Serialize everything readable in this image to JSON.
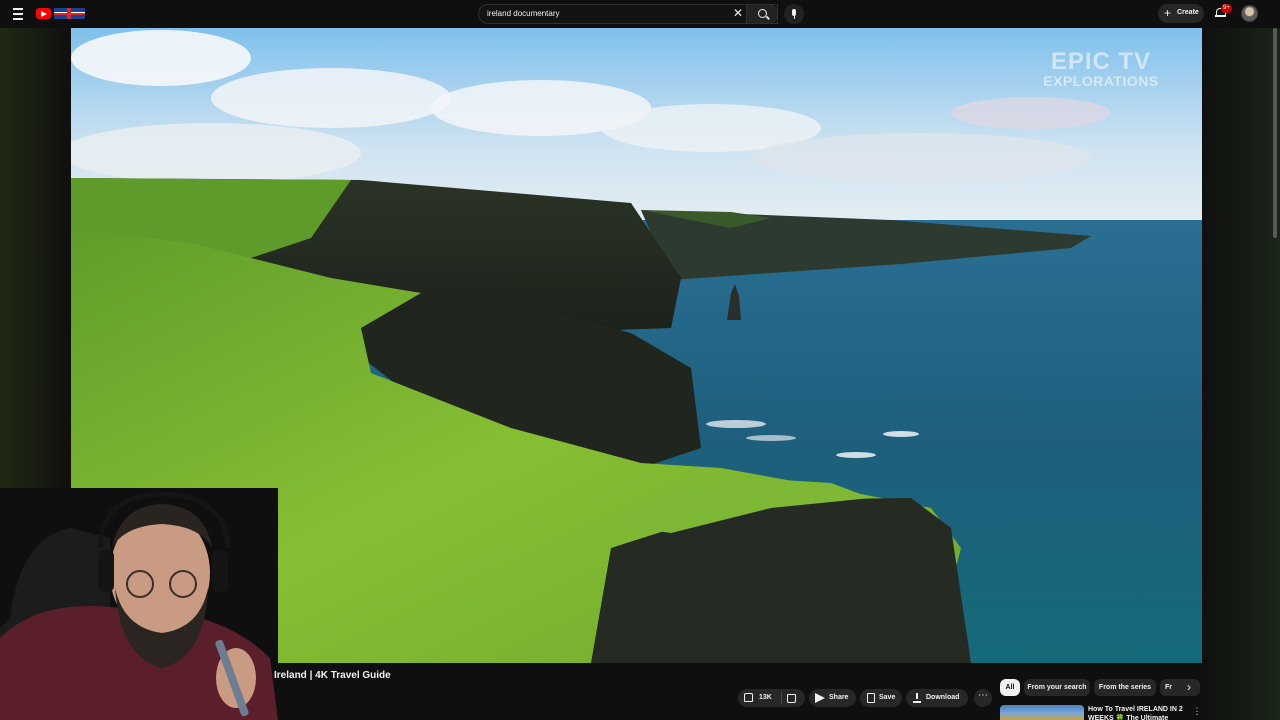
{
  "header": {
    "search_query": "ireland documentary",
    "create_label": "Create",
    "notification_count": "9+"
  },
  "video": {
    "watermark_line1": "EPIC TV",
    "watermark_line2": "EXPLORATIONS",
    "title": "Ireland | 4K Travel Guide"
  },
  "actions": {
    "like_count": "13K",
    "share_label": "Share",
    "save_label": "Save",
    "download_label": "Download"
  },
  "chips": [
    "All",
    "From your search",
    "From the series",
    "Fr"
  ],
  "recommendation": {
    "title": "How To Travel IRELAND IN 2 WEEKS 🍀 The Ultimate"
  },
  "colors": {
    "background": "#0f0f0f",
    "surface": "#272727",
    "accent": "#ff0000",
    "text": "#f1f1f1"
  },
  "icons": [
    "menu-icon",
    "youtube-logo-icon",
    "uk-flag-icon",
    "clear-icon",
    "search-icon",
    "microphone-icon",
    "plus-icon",
    "bell-icon",
    "thumbs-up-icon",
    "thumbs-down-icon",
    "share-icon",
    "bookmark-icon",
    "download-icon",
    "more-icon",
    "chevron-right-icon"
  ]
}
